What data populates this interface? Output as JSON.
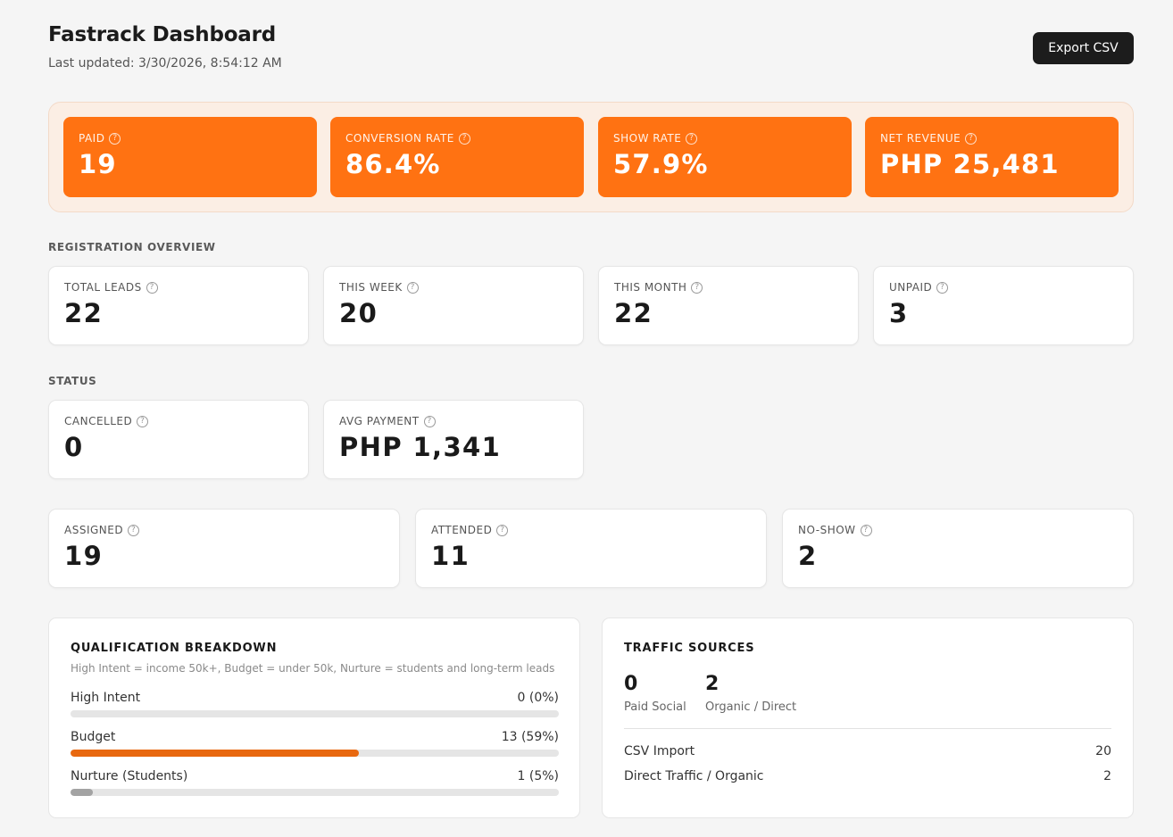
{
  "header": {
    "title": "Fastrack Dashboard",
    "last_updated": "Last updated: 3/30/2026, 8:54:12 AM",
    "export_label": "Export CSV"
  },
  "highlights": [
    {
      "label": "PAID",
      "value": "19"
    },
    {
      "label": "CONVERSION RATE",
      "value": "86.4%"
    },
    {
      "label": "SHOW RATE",
      "value": "57.9%"
    },
    {
      "label": "NET REVENUE",
      "value": "PHP 25,481"
    }
  ],
  "registration_overview": {
    "label": "REGISTRATION OVERVIEW",
    "cards": [
      {
        "label": "TOTAL LEADS",
        "value": "22"
      },
      {
        "label": "THIS WEEK",
        "value": "20"
      },
      {
        "label": "THIS MONTH",
        "value": "22"
      },
      {
        "label": "UNPAID",
        "value": "3"
      }
    ]
  },
  "status": {
    "label": "STATUS",
    "cards": [
      {
        "label": "CANCELLED",
        "value": "0"
      },
      {
        "label": "AVG PAYMENT",
        "value": "PHP 1,341"
      }
    ]
  },
  "attendance": {
    "cards": [
      {
        "label": "ASSIGNED",
        "value": "19"
      },
      {
        "label": "ATTENDED",
        "value": "11"
      },
      {
        "label": "NO-SHOW",
        "value": "2"
      }
    ]
  },
  "qualification": {
    "title": "QUALIFICATION BREAKDOWN",
    "subtitle": "High Intent = income 50k+, Budget = under 50k, Nurture = students and long-term leads",
    "rows": [
      {
        "name": "High Intent",
        "count": "0 (0%)",
        "fraction": 0.0,
        "color": "#ff7212"
      },
      {
        "name": "Budget",
        "count": "13 (59%)",
        "fraction": 0.59,
        "color": "#e8680f"
      },
      {
        "name": "Nurture (Students)",
        "count": "1 (5%)",
        "fraction": 0.045,
        "color": "#a3a3a3"
      }
    ]
  },
  "traffic": {
    "title": "TRAFFIC SOURCES",
    "summary": [
      {
        "value": "0",
        "label": "Paid Social"
      },
      {
        "value": "2",
        "label": "Organic / Direct"
      }
    ],
    "rows": [
      {
        "name": "CSV Import",
        "count": "20"
      },
      {
        "name": "Direct Traffic / Organic",
        "count": "2"
      }
    ]
  },
  "colors": {
    "accent": "#ff7212",
    "highlight_panel_bg": "#fbeee4"
  }
}
